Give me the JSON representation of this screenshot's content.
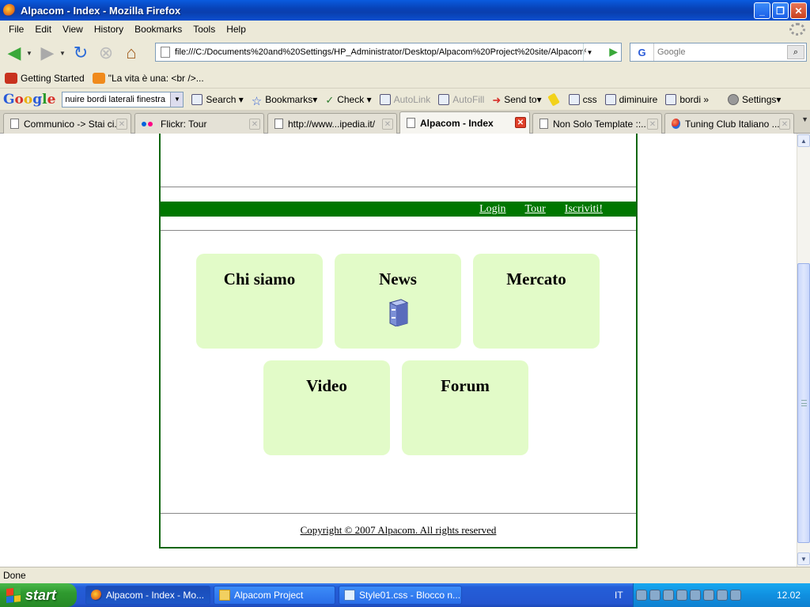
{
  "window": {
    "title": "Alpacom - Index - Mozilla Firefox"
  },
  "menu": [
    "File",
    "Edit",
    "View",
    "History",
    "Bookmarks",
    "Tools",
    "Help"
  ],
  "nav": {
    "url": "file:///C:/Documents%20and%20Settings/HP_Administrator/Desktop/Alpacom%20Project%20site/Alpacom%",
    "search_placeholder": "Google"
  },
  "bookmarks": [
    {
      "label": "Getting Started"
    },
    {
      "label": "\"La vita è una: <br />..."
    }
  ],
  "google_toolbar": {
    "search_value": "nuire bordi laterali finestra",
    "items": [
      {
        "label": "Search"
      },
      {
        "label": "Bookmarks"
      },
      {
        "label": "Check"
      },
      {
        "label": "AutoLink"
      },
      {
        "label": "AutoFill"
      },
      {
        "label": "Send to"
      },
      {
        "label": "css"
      },
      {
        "label": "diminuire"
      },
      {
        "label": "bordi"
      },
      {
        "label": "Settings"
      }
    ]
  },
  "tabs": [
    {
      "label": "Communico -> Stai ci..."
    },
    {
      "label": "Flickr: Tour"
    },
    {
      "label": "http://www...ipedia.it/"
    },
    {
      "label": "Alpacom - Index"
    },
    {
      "label": "Non Solo Template ::..."
    },
    {
      "label": "Tuning Club Italiano ..."
    }
  ],
  "site": {
    "nav_links": [
      "Login",
      "Tour",
      "Iscriviti!"
    ],
    "cards": [
      "Chi siamo",
      "News",
      "Mercato",
      "Video",
      "Forum"
    ],
    "copyright": "Copyright © 2007 Alpacom. All rights reserved"
  },
  "status": {
    "text": "Done"
  },
  "taskbar": {
    "start": "start",
    "tasks": [
      "Alpacom - Index - Mo...",
      "Alpacom Project",
      "Style01.css - Blocco n..."
    ],
    "lang": "IT",
    "clock": "12.02"
  },
  "colors": {
    "site_nav_green": "#007700",
    "card_bg": "#e2fbc8",
    "page_border": "#116611"
  }
}
